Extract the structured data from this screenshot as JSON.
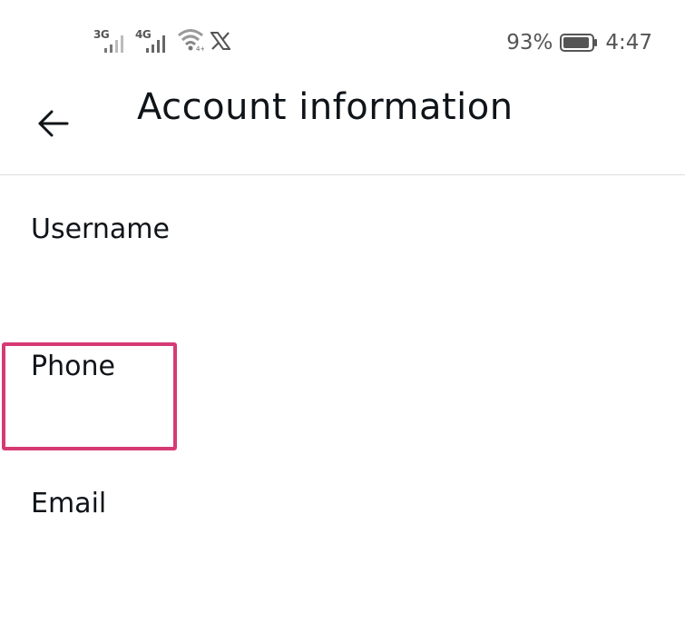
{
  "status_bar": {
    "network1": "3G",
    "network2": "4G",
    "battery_percent": "93%",
    "battery_level": 0.93,
    "time": "4:47",
    "icons": [
      "signal-icon",
      "signal-icon",
      "wifi-icon",
      "x-logo-icon",
      "battery-icon"
    ]
  },
  "header": {
    "back_icon": "arrow-left-icon",
    "title": "Account information"
  },
  "rows": [
    {
      "label": "Username",
      "value": ""
    },
    {
      "label": "Phone",
      "value": ""
    },
    {
      "label": "Email",
      "value": ""
    }
  ],
  "colors": {
    "highlight": "#d63a75",
    "text": "#0f1419",
    "divider": "#dcdcdc"
  }
}
